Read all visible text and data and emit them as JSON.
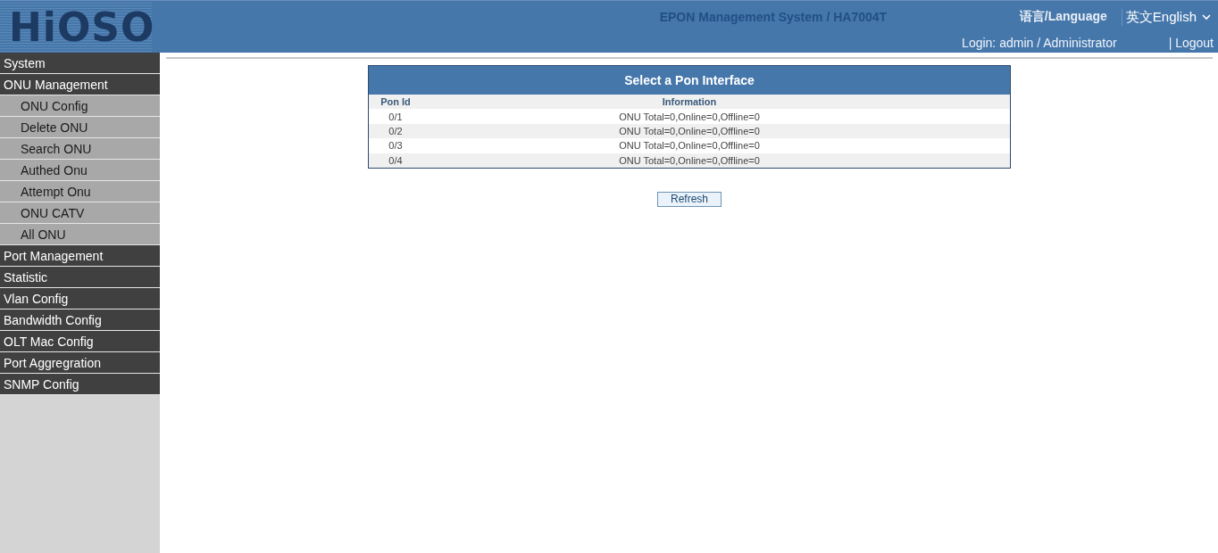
{
  "header": {
    "logo": "HiOSO",
    "system_title": "EPON Management System / HA7004T",
    "language_label": "语言/Language",
    "language_select": "英文English",
    "login": "Login: admin / Administrator",
    "logout": "| Logout"
  },
  "sidebar": {
    "items": [
      {
        "label": "System"
      },
      {
        "label": "ONU Management",
        "children": [
          {
            "label": "ONU Config"
          },
          {
            "label": "Delete ONU"
          },
          {
            "label": "Search ONU"
          },
          {
            "label": "Authed Onu"
          },
          {
            "label": "Attempt Onu"
          },
          {
            "label": "ONU CATV"
          },
          {
            "label": "All ONU"
          }
        ]
      },
      {
        "label": "Port Management"
      },
      {
        "label": "Statistic"
      },
      {
        "label": "Vlan Config"
      },
      {
        "label": "Bandwidth Config"
      },
      {
        "label": "OLT Mac Config"
      },
      {
        "label": "Port Aggregration"
      },
      {
        "label": "SNMP Config"
      }
    ]
  },
  "table": {
    "title": "Select a Pon Interface",
    "columns": [
      "Pon Id",
      "Information"
    ],
    "rows": [
      [
        "0/1",
        "ONU Total=0,Online=0,Offline=0"
      ],
      [
        "0/2",
        "ONU Total=0,Online=0,Offline=0"
      ],
      [
        "0/3",
        "ONU Total=0,Online=0,Offline=0"
      ],
      [
        "0/4",
        "ONU Total=0,Online=0,Offline=0"
      ]
    ]
  },
  "buttons": [
    "Refresh"
  ]
}
